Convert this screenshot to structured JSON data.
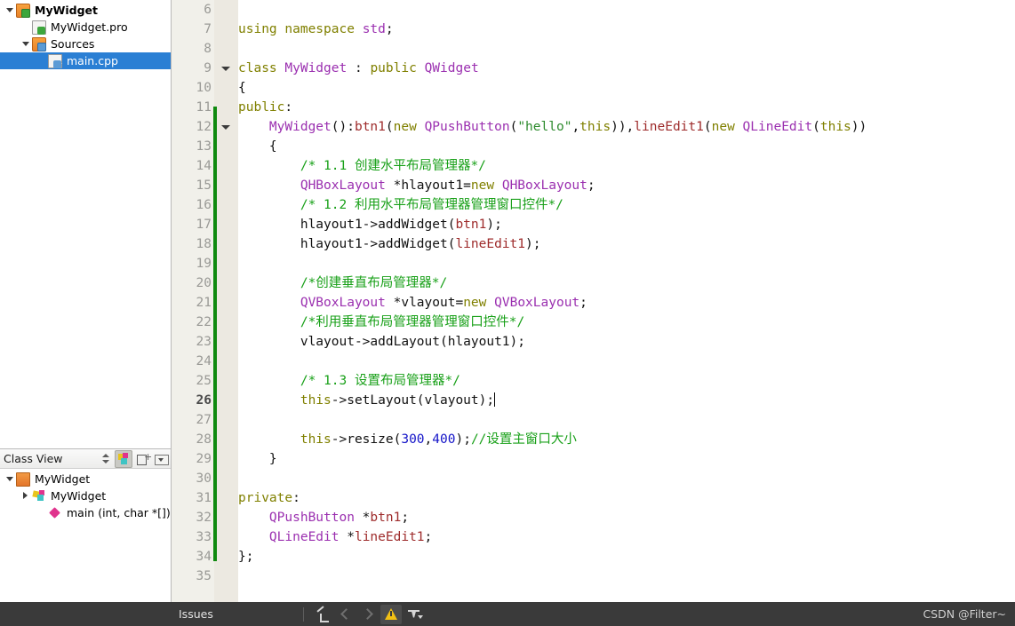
{
  "project_tree": {
    "items": [
      {
        "label": "MyWidget",
        "icon": "qt-project-folder-icon",
        "indent": 0,
        "twisty": "open",
        "bold": true,
        "selected": false
      },
      {
        "label": "MyWidget.pro",
        "icon": "qt-pro-file-icon",
        "indent": 1,
        "twisty": "none",
        "bold": false,
        "selected": false
      },
      {
        "label": "Sources",
        "icon": "cpp-sources-folder-icon",
        "indent": 1,
        "twisty": "open",
        "bold": false,
        "selected": false
      },
      {
        "label": "main.cpp",
        "icon": "cpp-file-icon",
        "indent": 2,
        "twisty": "none",
        "bold": false,
        "selected": true
      }
    ]
  },
  "class_view": {
    "title": "Class View",
    "toolbar": [
      {
        "name": "sort-updown-button",
        "active": false
      },
      {
        "name": "class-filter-button",
        "active": true
      },
      {
        "name": "expand-collapse-button",
        "active": false
      },
      {
        "name": "view-menu-button",
        "active": false
      }
    ],
    "items": [
      {
        "label": "MyWidget",
        "icon": "folder-icon",
        "indent": 0,
        "twisty": "open",
        "selected": false
      },
      {
        "label": "MyWidget",
        "icon": "class-icon",
        "indent": 1,
        "twisty": "closed",
        "selected": false
      },
      {
        "label": "main (int, char *[])",
        "icon": "function-icon",
        "indent": 2,
        "twisty": "none",
        "selected": false
      }
    ]
  },
  "editor": {
    "current_line": 26,
    "cursor_line": 26,
    "lines": [
      {
        "n": 6,
        "fold": false,
        "tokens": []
      },
      {
        "n": 7,
        "fold": false,
        "tokens": [
          {
            "t": "using",
            "c": "kw"
          },
          {
            "t": " ",
            "c": ""
          },
          {
            "t": "namespace",
            "c": "kw"
          },
          {
            "t": " ",
            "c": ""
          },
          {
            "t": "std",
            "c": "type"
          },
          {
            "t": ";",
            "c": ""
          }
        ]
      },
      {
        "n": 8,
        "fold": false,
        "tokens": []
      },
      {
        "n": 9,
        "fold": true,
        "tokens": [
          {
            "t": "class",
            "c": "kw"
          },
          {
            "t": " ",
            "c": ""
          },
          {
            "t": "MyWidget",
            "c": "type"
          },
          {
            "t": " : ",
            "c": ""
          },
          {
            "t": "public",
            "c": "kw"
          },
          {
            "t": " ",
            "c": ""
          },
          {
            "t": "QWidget",
            "c": "type"
          }
        ]
      },
      {
        "n": 10,
        "fold": false,
        "tokens": [
          {
            "t": "{",
            "c": ""
          }
        ]
      },
      {
        "n": 11,
        "fold": false,
        "tokens": [
          {
            "t": "public",
            "c": "kw"
          },
          {
            "t": ":",
            "c": ""
          }
        ]
      },
      {
        "n": 12,
        "fold": true,
        "tokens": [
          {
            "t": "    ",
            "c": ""
          },
          {
            "t": "MyWidget",
            "c": "type"
          },
          {
            "t": "():",
            "c": ""
          },
          {
            "t": "btn1",
            "c": "mem"
          },
          {
            "t": "(",
            "c": ""
          },
          {
            "t": "new",
            "c": "kw"
          },
          {
            "t": " ",
            "c": ""
          },
          {
            "t": "QPushButton",
            "c": "type"
          },
          {
            "t": "(",
            "c": ""
          },
          {
            "t": "\"hello\"",
            "c": "str"
          },
          {
            "t": ",",
            "c": ""
          },
          {
            "t": "this",
            "c": "kw"
          },
          {
            "t": ")),",
            "c": ""
          },
          {
            "t": "lineEdit1",
            "c": "mem"
          },
          {
            "t": "(",
            "c": ""
          },
          {
            "t": "new",
            "c": "kw"
          },
          {
            "t": " ",
            "c": ""
          },
          {
            "t": "QLineEdit",
            "c": "type"
          },
          {
            "t": "(",
            "c": ""
          },
          {
            "t": "this",
            "c": "kw"
          },
          {
            "t": "))",
            "c": ""
          }
        ]
      },
      {
        "n": 13,
        "fold": false,
        "tokens": [
          {
            "t": "    {",
            "c": ""
          }
        ]
      },
      {
        "n": 14,
        "fold": false,
        "tokens": [
          {
            "t": "        ",
            "c": ""
          },
          {
            "t": "/* 1.1 创建水平布局管理器*/",
            "c": "cmt"
          }
        ]
      },
      {
        "n": 15,
        "fold": false,
        "tokens": [
          {
            "t": "        ",
            "c": ""
          },
          {
            "t": "QHBoxLayout",
            "c": "type"
          },
          {
            "t": " *hlayout1=",
            "c": ""
          },
          {
            "t": "new",
            "c": "kw"
          },
          {
            "t": " ",
            "c": ""
          },
          {
            "t": "QHBoxLayout",
            "c": "type"
          },
          {
            "t": ";",
            "c": ""
          }
        ]
      },
      {
        "n": 16,
        "fold": false,
        "tokens": [
          {
            "t": "        ",
            "c": ""
          },
          {
            "t": "/* 1.2 利用水平布局管理器管理窗口控件*/",
            "c": "cmt"
          }
        ]
      },
      {
        "n": 17,
        "fold": false,
        "tokens": [
          {
            "t": "        hlayout1->addWidget(",
            "c": ""
          },
          {
            "t": "btn1",
            "c": "mem"
          },
          {
            "t": ");",
            "c": ""
          }
        ]
      },
      {
        "n": 18,
        "fold": false,
        "tokens": [
          {
            "t": "        hlayout1->addWidget(",
            "c": ""
          },
          {
            "t": "lineEdit1",
            "c": "mem"
          },
          {
            "t": ");",
            "c": ""
          }
        ]
      },
      {
        "n": 19,
        "fold": false,
        "tokens": []
      },
      {
        "n": 20,
        "fold": false,
        "tokens": [
          {
            "t": "        ",
            "c": ""
          },
          {
            "t": "/*创建垂直布局管理器*/",
            "c": "cmt"
          }
        ]
      },
      {
        "n": 21,
        "fold": false,
        "tokens": [
          {
            "t": "        ",
            "c": ""
          },
          {
            "t": "QVBoxLayout",
            "c": "type"
          },
          {
            "t": " *vlayout=",
            "c": ""
          },
          {
            "t": "new",
            "c": "kw"
          },
          {
            "t": " ",
            "c": ""
          },
          {
            "t": "QVBoxLayout",
            "c": "type"
          },
          {
            "t": ";",
            "c": ""
          }
        ]
      },
      {
        "n": 22,
        "fold": false,
        "tokens": [
          {
            "t": "        ",
            "c": ""
          },
          {
            "t": "/*利用垂直布局管理器管理窗口控件*/",
            "c": "cmt"
          }
        ]
      },
      {
        "n": 23,
        "fold": false,
        "tokens": [
          {
            "t": "        vlayout->addLayout(hlayout1);",
            "c": ""
          }
        ]
      },
      {
        "n": 24,
        "fold": false,
        "tokens": []
      },
      {
        "n": 25,
        "fold": false,
        "tokens": [
          {
            "t": "        ",
            "c": ""
          },
          {
            "t": "/* 1.3 设置布局管理器*/",
            "c": "cmt"
          }
        ]
      },
      {
        "n": 26,
        "fold": false,
        "tokens": [
          {
            "t": "        ",
            "c": ""
          },
          {
            "t": "this",
            "c": "kw"
          },
          {
            "t": "->setLayout(vlayout);",
            "c": ""
          },
          {
            "t": "|CARET|",
            "c": "caret"
          }
        ]
      },
      {
        "n": 27,
        "fold": false,
        "tokens": []
      },
      {
        "n": 28,
        "fold": false,
        "tokens": [
          {
            "t": "        ",
            "c": ""
          },
          {
            "t": "this",
            "c": "kw"
          },
          {
            "t": "->resize(",
            "c": ""
          },
          {
            "t": "300",
            "c": "num"
          },
          {
            "t": ",",
            "c": ""
          },
          {
            "t": "400",
            "c": "num"
          },
          {
            "t": ");",
            "c": ""
          },
          {
            "t": "//设置主窗口大小",
            "c": "cmt"
          }
        ]
      },
      {
        "n": 29,
        "fold": false,
        "tokens": [
          {
            "t": "    }",
            "c": ""
          }
        ]
      },
      {
        "n": 30,
        "fold": false,
        "tokens": []
      },
      {
        "n": 31,
        "fold": false,
        "tokens": [
          {
            "t": "private",
            "c": "kw"
          },
          {
            "t": ":",
            "c": ""
          }
        ]
      },
      {
        "n": 32,
        "fold": false,
        "tokens": [
          {
            "t": "    ",
            "c": ""
          },
          {
            "t": "QPushButton",
            "c": "type"
          },
          {
            "t": " *",
            "c": ""
          },
          {
            "t": "btn1",
            "c": "mem"
          },
          {
            "t": ";",
            "c": ""
          }
        ]
      },
      {
        "n": 33,
        "fold": false,
        "tokens": [
          {
            "t": "    ",
            "c": ""
          },
          {
            "t": "QLineEdit",
            "c": "type"
          },
          {
            "t": " *",
            "c": ""
          },
          {
            "t": "lineEdit1",
            "c": "mem"
          },
          {
            "t": ";",
            "c": ""
          }
        ]
      },
      {
        "n": 34,
        "fold": false,
        "tokens": [
          {
            "t": "};",
            "c": ""
          }
        ]
      },
      {
        "n": 35,
        "fold": false,
        "tokens": []
      }
    ]
  },
  "status_bar": {
    "issues_label": "Issues",
    "buttons": [
      {
        "name": "clear-issues-button",
        "icon": "broom-icon",
        "active": false
      },
      {
        "name": "previous-issue-button",
        "icon": "chevron-left-icon",
        "active": false
      },
      {
        "name": "next-issue-button",
        "icon": "chevron-right-icon",
        "active": false
      },
      {
        "name": "warnings-filter-button",
        "icon": "warning-icon",
        "active": true
      },
      {
        "name": "filter-menu-button",
        "icon": "filter-icon",
        "active": false
      }
    ],
    "watermark": "CSDN @Filter~"
  },
  "colors": {
    "selection_blue": "#2a7fd4",
    "keyword": "#808000",
    "type": "#9b30b0",
    "comment": "#18a018",
    "string": "#2e8b2e",
    "member": "#9e2b2b",
    "number": "#1414c8",
    "change_bar_green": "#0f8a0f",
    "gutter_bg": "#f1f0ea",
    "status_bar_bg": "#3a3a3a",
    "warning_yellow": "#f2c014"
  }
}
